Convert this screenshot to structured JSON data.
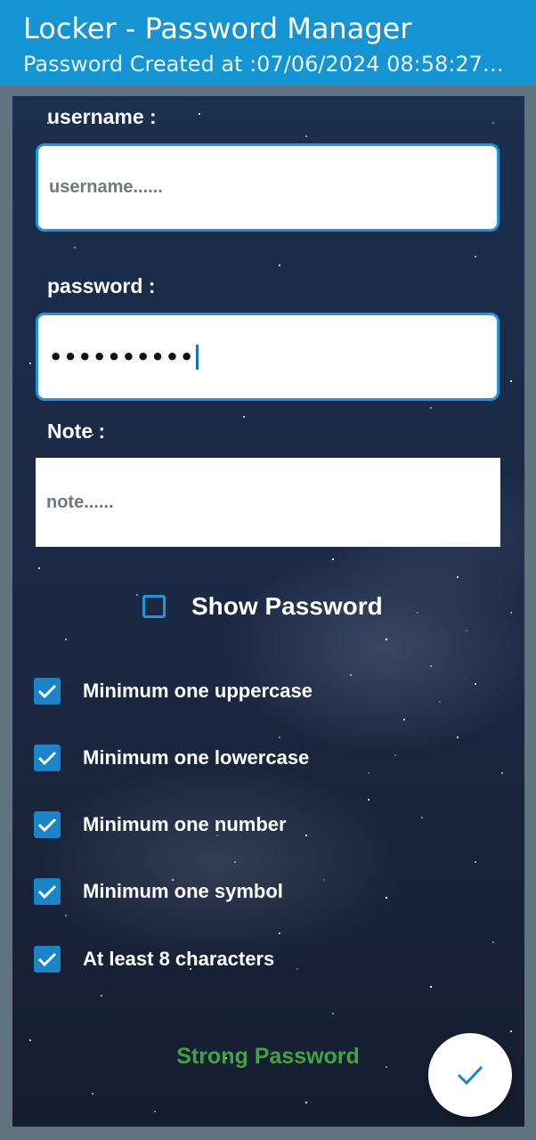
{
  "appbar": {
    "title": "Locker - Password Manager",
    "subtitle": "Password Created at :07/06/2024 08:58:27…"
  },
  "form": {
    "username": {
      "label": "username :",
      "placeholder": "username......",
      "value": ""
    },
    "password": {
      "label": "password :",
      "value_masked": "••••••••••"
    },
    "note": {
      "label": "Note :",
      "placeholder": "note......",
      "value": ""
    }
  },
  "show_password": {
    "label": "Show Password",
    "checked": false
  },
  "rules": [
    {
      "label": "Minimum one uppercase",
      "checked": true
    },
    {
      "label": "Minimum one lowercase",
      "checked": true
    },
    {
      "label": "Minimum one number",
      "checked": true
    },
    {
      "label": "Minimum one symbol",
      "checked": true
    },
    {
      "label": "At least 8 characters",
      "checked": true
    }
  ],
  "strength": {
    "text": "Strong Password",
    "color": "#3fa53f"
  },
  "colors": {
    "appbar": "#1594d4",
    "accent": "#2196d8",
    "checkbox": "#1b84c8"
  },
  "icons": {
    "fab": "check-icon"
  }
}
